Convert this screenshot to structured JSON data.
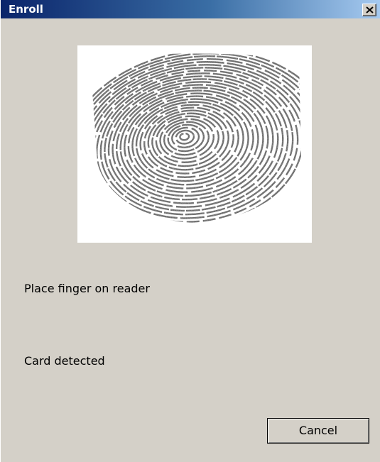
{
  "window": {
    "title": "Enroll",
    "close_icon": "close-icon"
  },
  "fingerprint": {
    "icon": "fingerprint-image"
  },
  "status": {
    "instruction": "Place finger on reader",
    "detection": "Card detected"
  },
  "buttons": {
    "cancel_label": "Cancel"
  },
  "colors": {
    "title_start": "#0a246a",
    "title_end": "#a6caf0",
    "face": "#d4d0c8"
  }
}
